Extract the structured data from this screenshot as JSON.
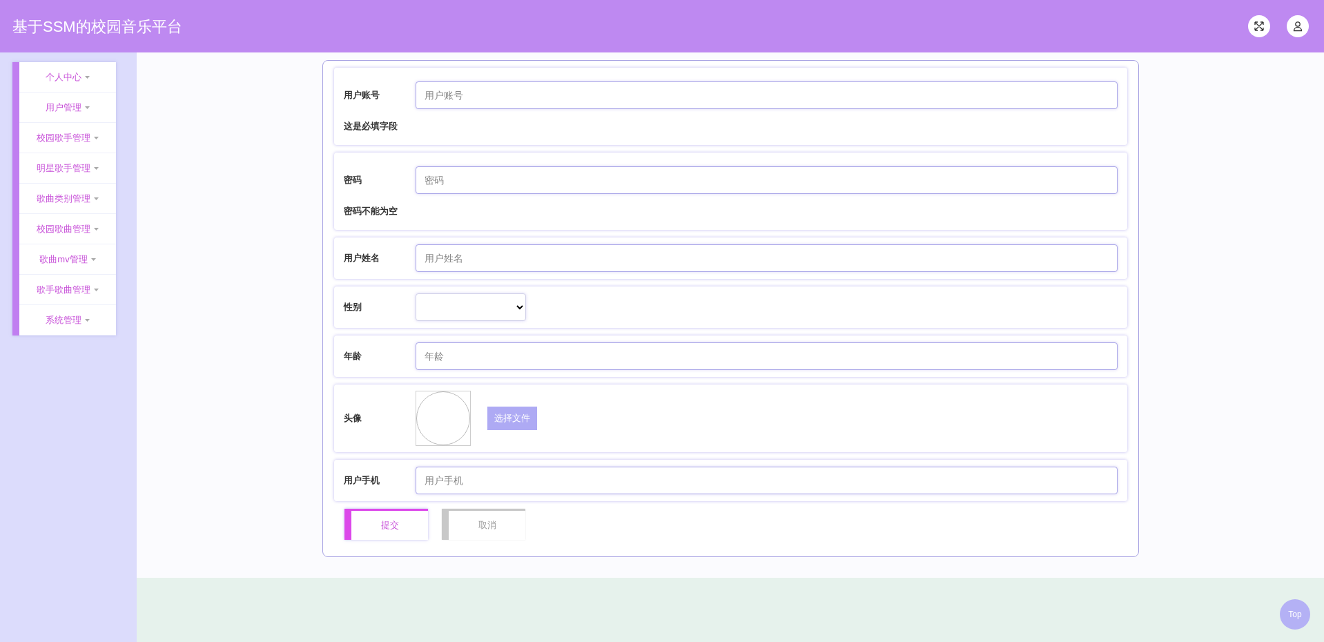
{
  "header": {
    "title": "基于SSM的校园音乐平台"
  },
  "sidebar": {
    "items": [
      {
        "label": "个人中心",
        "expanded": false
      },
      {
        "label": "用户管理",
        "expanded": false
      },
      {
        "label": "校园歌手管理",
        "expanded": false
      },
      {
        "label": "明星歌手管理",
        "expanded": false
      },
      {
        "label": "歌曲类别管理",
        "expanded": false
      },
      {
        "label": "校园歌曲管理",
        "expanded": false
      },
      {
        "label": "歌曲mv管理",
        "expanded": false
      },
      {
        "label": "歌手歌曲管理",
        "expanded": false
      },
      {
        "label": "系统管理",
        "expanded": false
      }
    ]
  },
  "form": {
    "fields": [
      {
        "kind": "input",
        "label": "用户账号",
        "placeholder": "用户账号",
        "error": "这是必填字段"
      },
      {
        "kind": "input",
        "label": "密码",
        "placeholder": "密码",
        "error": "密码不能为空"
      },
      {
        "kind": "input",
        "label": "用户姓名",
        "placeholder": "用户姓名"
      },
      {
        "kind": "select",
        "label": "性别"
      },
      {
        "kind": "input",
        "label": "年龄",
        "placeholder": "年龄"
      },
      {
        "kind": "image",
        "label": "头像",
        "button": "选择文件"
      },
      {
        "kind": "input",
        "label": "用户手机",
        "placeholder": "用户手机"
      }
    ],
    "buttons": [
      {
        "label": "提交",
        "kind": "primary"
      },
      {
        "label": "取消",
        "kind": "secondary"
      }
    ]
  },
  "back_to_top": "Top"
}
